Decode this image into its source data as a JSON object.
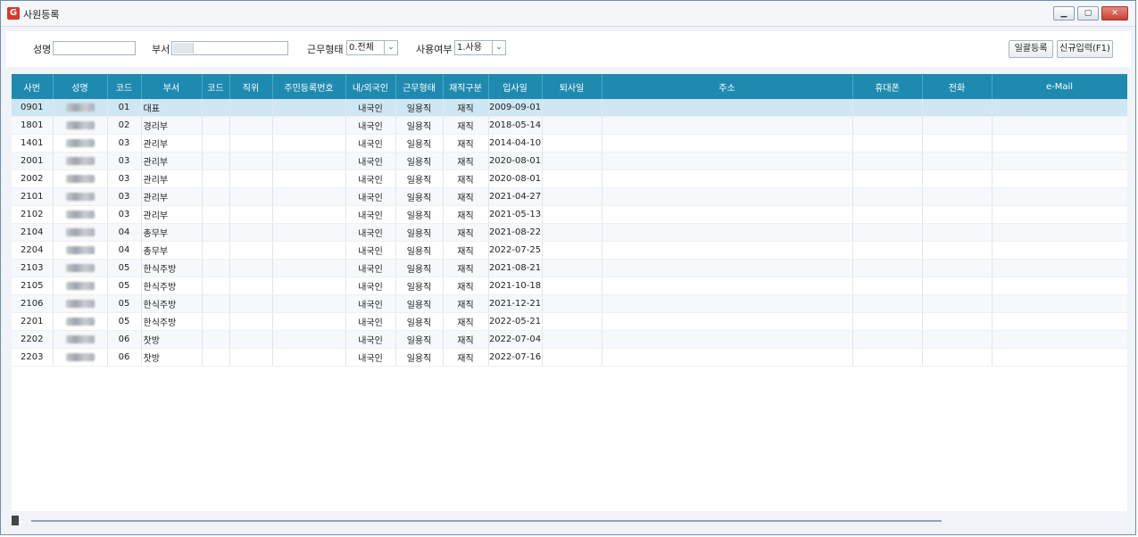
{
  "window": {
    "title": "사원등록",
    "app_icon": "app-logo-icon"
  },
  "filters": {
    "name_label": "성명",
    "name_value": "",
    "dept_label": "부서",
    "dept_value": "",
    "worktype_label": "근무형태",
    "worktype_value": "0.전체",
    "use_label": "사용여부",
    "use_value": "1.사용"
  },
  "buttons": {
    "bulk": "일괄등록",
    "new": "신규입력(F1)"
  },
  "table": {
    "headers": [
      "사번",
      "성명",
      "코드",
      "부서",
      "코드",
      "직위",
      "주민등록번호",
      "내/외국인",
      "근무형태",
      "재직구분",
      "입사일",
      "퇴사일",
      "주소",
      "휴대폰",
      "전화",
      "e-Mail"
    ],
    "rows": [
      {
        "id": "0901",
        "code": "01",
        "dept": "대표",
        "nat": "내국인",
        "work": "일용직",
        "status": "재직",
        "join": "2009-09-01"
      },
      {
        "id": "1801",
        "code": "02",
        "dept": "경리부",
        "nat": "내국인",
        "work": "일용직",
        "status": "재직",
        "join": "2018-05-14"
      },
      {
        "id": "1401",
        "code": "03",
        "dept": "관리부",
        "nat": "내국인",
        "work": "일용직",
        "status": "재직",
        "join": "2014-04-10"
      },
      {
        "id": "2001",
        "code": "03",
        "dept": "관리부",
        "nat": "내국인",
        "work": "일용직",
        "status": "재직",
        "join": "2020-08-01"
      },
      {
        "id": "2002",
        "code": "03",
        "dept": "관리부",
        "nat": "내국인",
        "work": "일용직",
        "status": "재직",
        "join": "2020-08-01"
      },
      {
        "id": "2101",
        "code": "03",
        "dept": "관리부",
        "nat": "내국인",
        "work": "일용직",
        "status": "재직",
        "join": "2021-04-27"
      },
      {
        "id": "2102",
        "code": "03",
        "dept": "관리부",
        "nat": "내국인",
        "work": "일용직",
        "status": "재직",
        "join": "2021-05-13"
      },
      {
        "id": "2104",
        "code": "04",
        "dept": "총무부",
        "nat": "내국인",
        "work": "일용직",
        "status": "재직",
        "join": "2021-08-22"
      },
      {
        "id": "2204",
        "code": "04",
        "dept": "총무부",
        "nat": "내국인",
        "work": "일용직",
        "status": "재직",
        "join": "2022-07-25"
      },
      {
        "id": "2103",
        "code": "05",
        "dept": "한식주방",
        "nat": "내국인",
        "work": "일용직",
        "status": "재직",
        "join": "2021-08-21"
      },
      {
        "id": "2105",
        "code": "05",
        "dept": "한식주방",
        "nat": "내국인",
        "work": "일용직",
        "status": "재직",
        "join": "2021-10-18"
      },
      {
        "id": "2106",
        "code": "05",
        "dept": "한식주방",
        "nat": "내국인",
        "work": "일용직",
        "status": "재직",
        "join": "2021-12-21"
      },
      {
        "id": "2201",
        "code": "05",
        "dept": "한식주방",
        "nat": "내국인",
        "work": "일용직",
        "status": "재직",
        "join": "2022-05-21"
      },
      {
        "id": "2202",
        "code": "06",
        "dept": "찻방",
        "nat": "내국인",
        "work": "일용직",
        "status": "재직",
        "join": "2022-07-04"
      },
      {
        "id": "2203",
        "code": "06",
        "dept": "찻방",
        "nat": "내국인",
        "work": "일용직",
        "status": "재직",
        "join": "2022-07-16"
      }
    ]
  },
  "colors": {
    "header_bg": "#1f8ab0",
    "selected_row": "#cfe6f3"
  }
}
